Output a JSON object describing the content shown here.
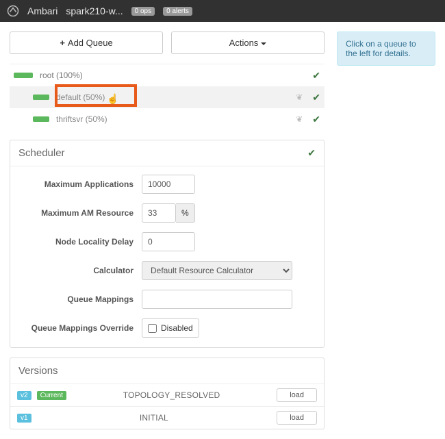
{
  "topbar": {
    "brand": "Ambari",
    "cluster": "spark210-w...",
    "ops_badge": "0 ops",
    "alerts_badge": "0 alerts"
  },
  "buttons": {
    "add_queue": "Add Queue",
    "actions": "Actions"
  },
  "queues": {
    "root": {
      "label": "root (100%)"
    },
    "default": {
      "label": "default (50%)"
    },
    "thriftsvr": {
      "label": "thriftsvr (50%)"
    }
  },
  "scheduler": {
    "title": "Scheduler",
    "max_apps_label": "Maximum Applications",
    "max_apps_value": "10000",
    "max_am_label": "Maximum AM Resource",
    "max_am_value": "33",
    "max_am_unit": "%",
    "node_locality_label": "Node Locality Delay",
    "node_locality_value": "0",
    "calculator_label": "Calculator",
    "calculator_value": "Default Resource Calculator",
    "queue_mappings_label": "Queue Mappings",
    "queue_mappings_value": "",
    "queue_override_label": "Queue Mappings Override",
    "queue_override_text": "Disabled"
  },
  "versions": {
    "title": "Versions",
    "items": [
      {
        "badge": "v2",
        "current": "Current",
        "label": "TOPOLOGY_RESOLVED",
        "load": "load"
      },
      {
        "badge": "v1",
        "current": "",
        "label": "INITIAL",
        "load": "load"
      }
    ]
  },
  "hint": "Click on a queue to the left for details."
}
